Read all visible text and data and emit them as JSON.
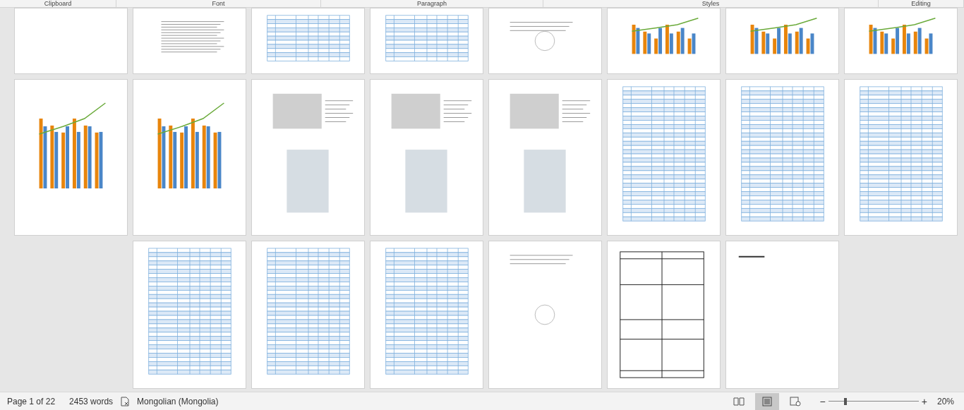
{
  "ribbon_groups": [
    "Clipboard",
    "Font",
    "Paragraph",
    "Styles",
    "Editing"
  ],
  "page_rows": [
    {
      "pages": [
        {
          "kind": "blank"
        },
        {
          "kind": "toc"
        },
        {
          "kind": "table"
        },
        {
          "kind": "table"
        },
        {
          "kind": "text"
        },
        {
          "kind": "chart"
        },
        {
          "kind": "chart"
        },
        {
          "kind": "chart"
        }
      ]
    },
    {
      "pages": [
        {
          "kind": "chart"
        },
        {
          "kind": "chart"
        },
        {
          "kind": "photos"
        },
        {
          "kind": "photos"
        },
        {
          "kind": "photos"
        },
        {
          "kind": "table"
        },
        {
          "kind": "table"
        },
        {
          "kind": "table"
        }
      ]
    },
    {
      "pages": [
        {
          "kind": "table"
        },
        {
          "kind": "table"
        },
        {
          "kind": "table"
        },
        {
          "kind": "text"
        },
        {
          "kind": "grid"
        },
        {
          "kind": "heading"
        }
      ]
    }
  ],
  "status_bar": {
    "page_info": "Page 1 of 22",
    "word_count": "2453 words",
    "language": "Mongolian (Mongolia)",
    "views": [
      {
        "kind": "read",
        "selected": false
      },
      {
        "kind": "print",
        "selected": true
      },
      {
        "kind": "web",
        "selected": false
      }
    ],
    "zoom_out": "−",
    "zoom_in": "+",
    "zoom": {
      "level": 0.18,
      "reading": "20%"
    }
  }
}
